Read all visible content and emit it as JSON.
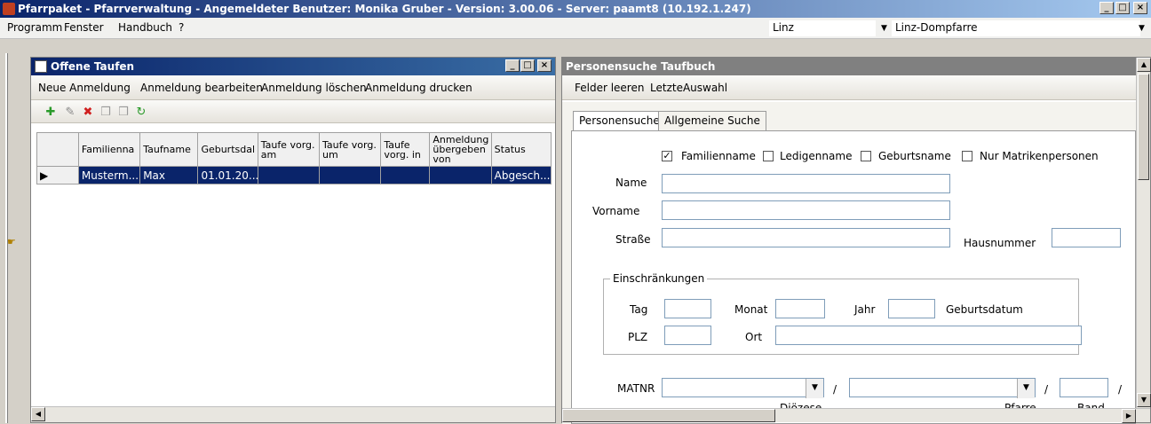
{
  "app": {
    "title": "Pfarrpaket - Pfarrverwaltung - Angemeldeter Benutzer: Monika Gruber - Version: 3.00.06 - Server: paamt8 (10.192.1.247)",
    "min": "_",
    "max": "□",
    "close": "×"
  },
  "menu": {
    "programm": "Programm",
    "fenster": "Fenster",
    "handbuch": "Handbuch",
    "help": "?"
  },
  "location": {
    "diocese": "Linz",
    "parish": "Linz-Dompfarre"
  },
  "left_panel": {
    "title": "Offene Taufen",
    "toolbar": [
      "Neue Anmeldung",
      "Anmeldung bearbeiten",
      "Anmeldung löschen",
      "Anmeldung drucken"
    ],
    "columns": [
      "Familienna",
      "Taufname",
      "Geburtsdal",
      "Taufe vorg. am",
      "Taufe vorg. um",
      "Taufe vorg. in",
      "Anmeldung übergeben von",
      "Status"
    ],
    "rows": [
      [
        "Musterm...",
        "Max",
        "01.01.20...",
        "",
        "",
        "",
        "",
        "Abgesch..."
      ]
    ]
  },
  "right_panel": {
    "title": "Personensuche Taufbuch",
    "toolbar": [
      "Felder leeren",
      "LetzteAuswahl"
    ],
    "tabs": [
      "Personensuche",
      "Allgemeine Suche"
    ],
    "checks": [
      {
        "label": "Familienname",
        "checked": true
      },
      {
        "label": "Ledigenname",
        "checked": false
      },
      {
        "label": "Geburtsname",
        "checked": false
      },
      {
        "label": "Nur Matrikenpersonen",
        "checked": false
      }
    ],
    "fields": {
      "name": "Name",
      "vorname": "Vorname",
      "strasse": "Straße",
      "hausnummer": "Hausnummer"
    },
    "group": {
      "title": "Einschränkungen",
      "tag": "Tag",
      "monat": "Monat",
      "jahr": "Jahr",
      "geburtsdatum": "Geburtsdatum",
      "plz": "PLZ",
      "ort": "Ort"
    },
    "matnr": {
      "label": "MATNR",
      "sep": "/",
      "dioezese": "Diözese",
      "pfarre": "Pfarre",
      "band": "Band"
    }
  }
}
